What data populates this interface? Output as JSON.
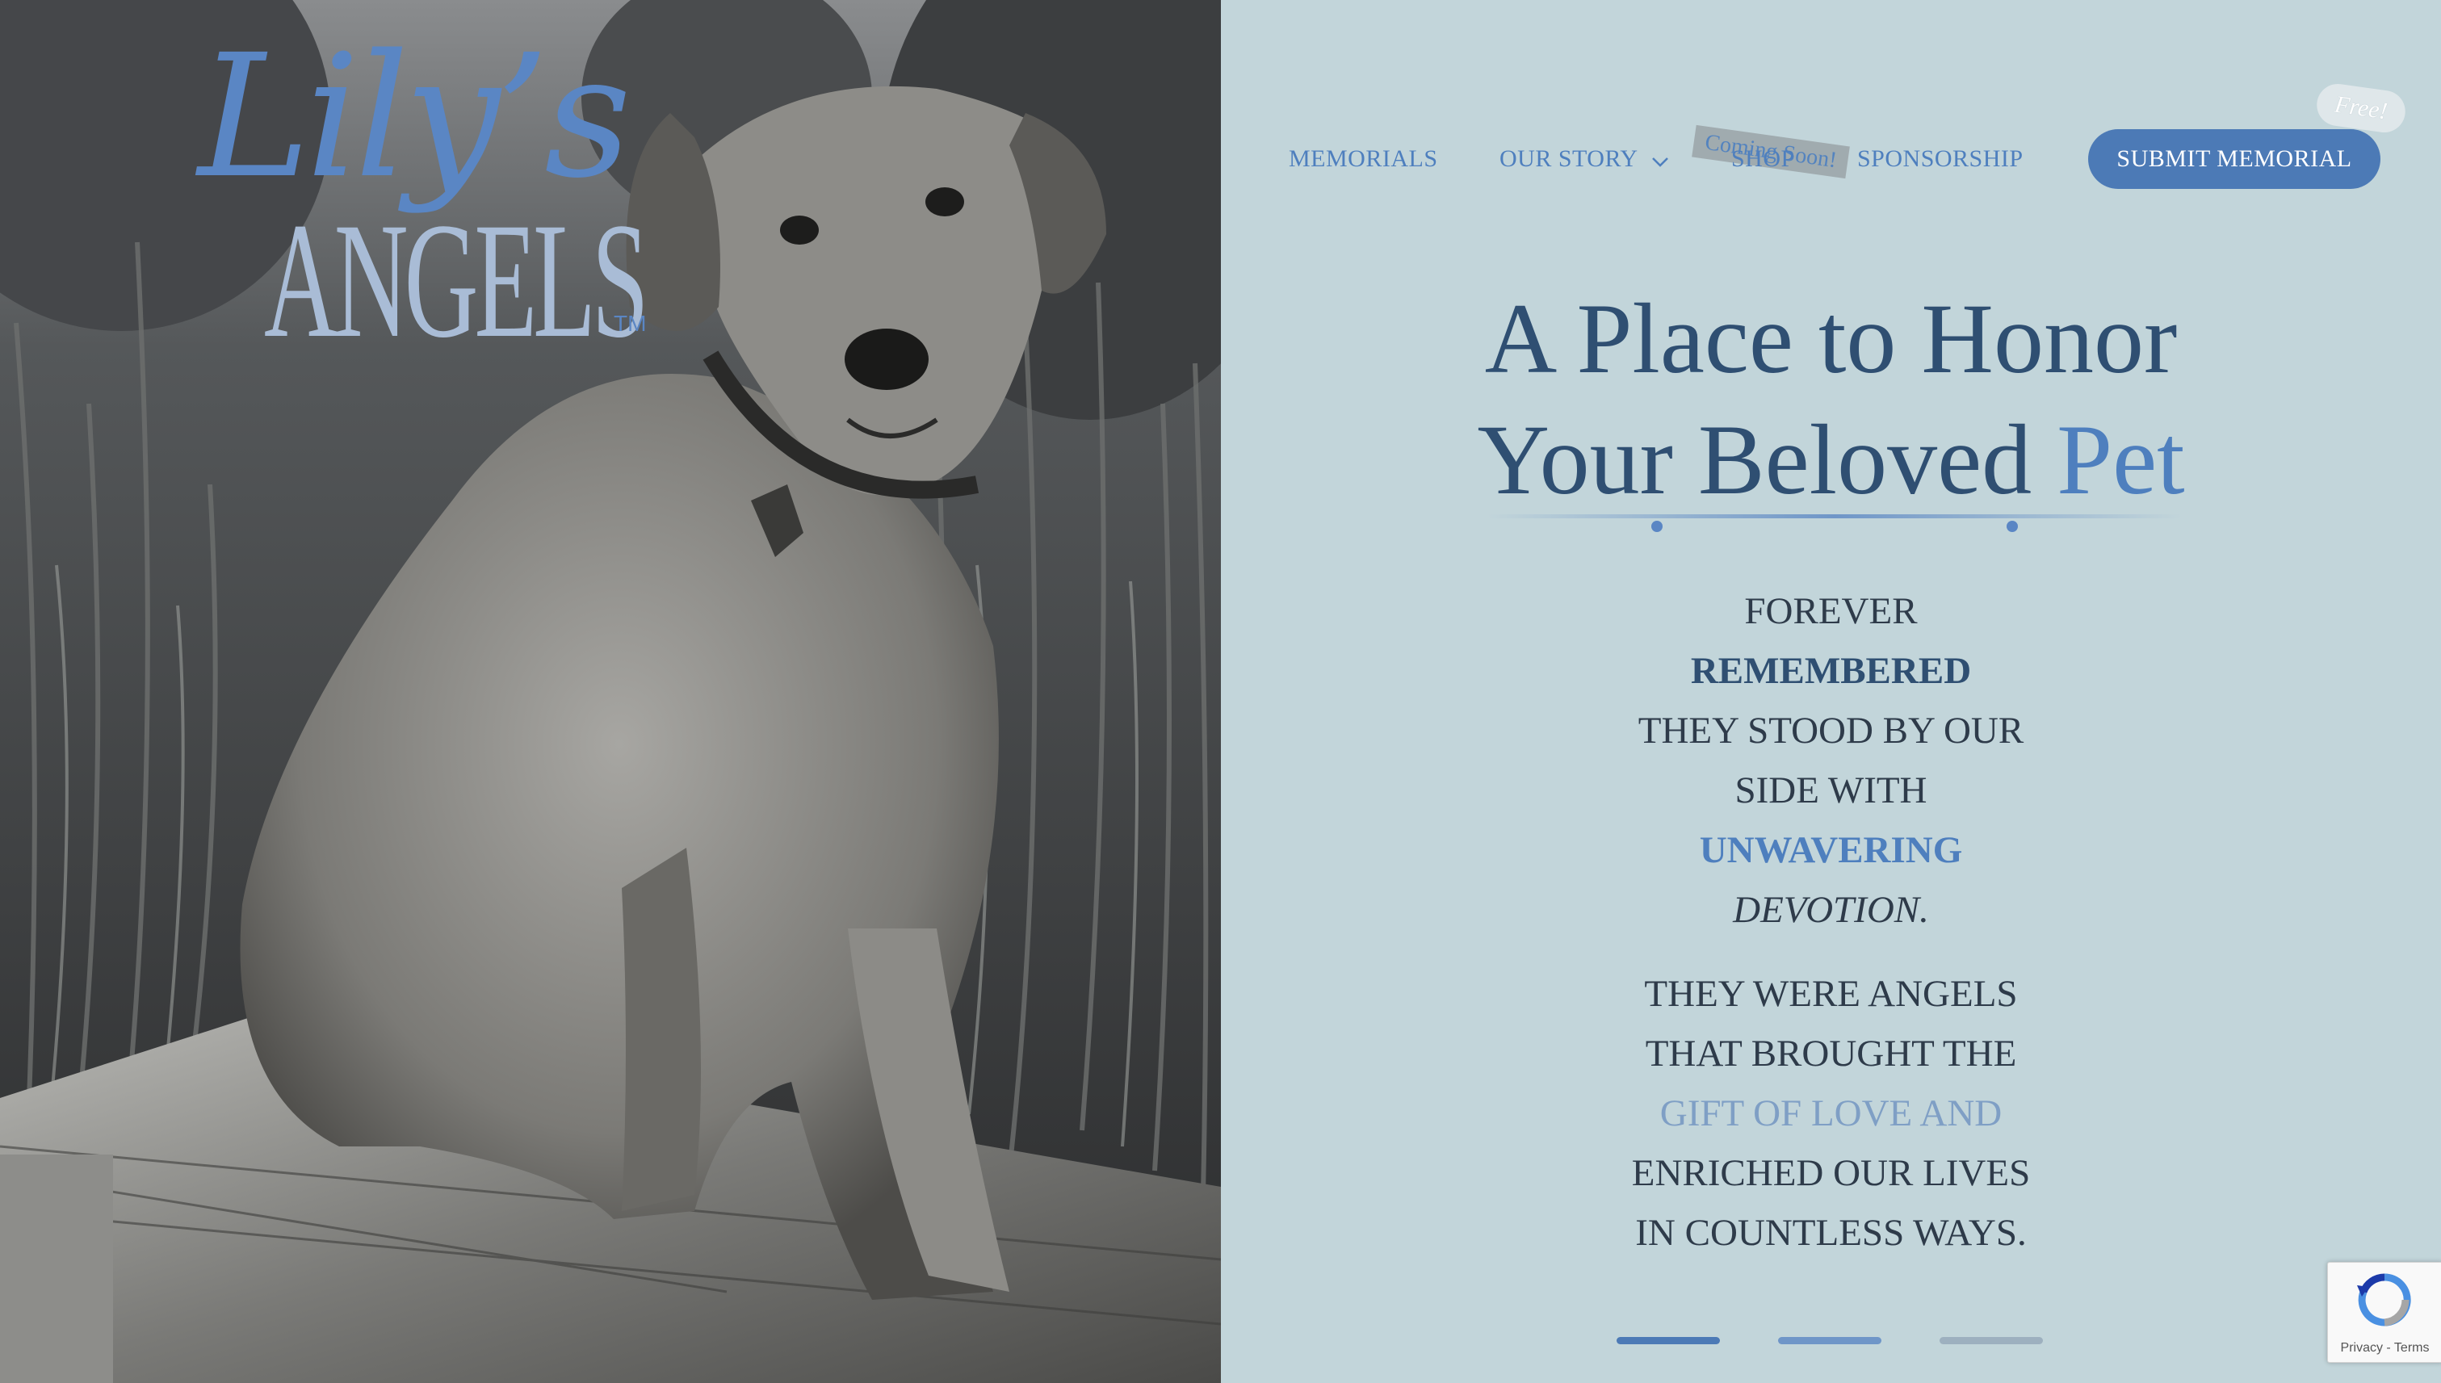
{
  "logo": {
    "script_text": "Lily’s",
    "wordmark_text": "ANGELS",
    "trademark": "TM"
  },
  "nav": {
    "items": [
      {
        "label": "MEMORIALS"
      },
      {
        "label": "OUR STORY"
      },
      {
        "label": "SHOP"
      },
      {
        "label": "SPONSORSHIP"
      }
    ],
    "shop_badge": "Coming Soon!",
    "submit_button": "SUBMIT MEMORIAL",
    "free_badge": "Free!"
  },
  "hero": {
    "title_line1": "A Place to Honor",
    "title_line2_plain": "Your Beloved",
    "title_line2_accent": "Pet"
  },
  "tagline": {
    "block1": [
      "FOREVER",
      "REMEMBERED",
      "THEY STOOD BY OUR",
      "SIDE WITH",
      "UNWAVERING",
      "DEVOTION."
    ],
    "block2": [
      "THEY WERE ANGELS",
      "THAT BROUGHT THE",
      "GIFT OF LOVE AND",
      "ENRICHED OUR LIVES",
      "IN COUNTLESS WAYS."
    ]
  },
  "slider": {
    "slides": 3,
    "active_index": 0
  },
  "recaptcha": {
    "text": "Privacy - Terms"
  },
  "colors": {
    "panel_bg": "#c2d5da",
    "accent_blue": "#4e7fbe",
    "navy": "#2f4f72",
    "button_bg": "#4c7ab6"
  },
  "icons": {
    "dropdown": "chevron-down-icon",
    "recaptcha": "recaptcha-icon"
  }
}
